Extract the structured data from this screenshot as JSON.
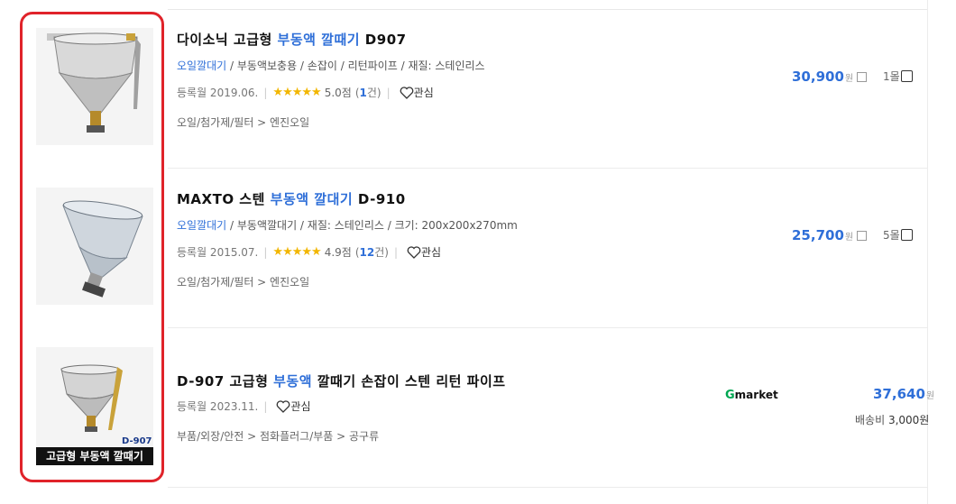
{
  "products": [
    {
      "title_pre": "다이소닉 고급형 ",
      "title_hl": "부동액 깔때기",
      "title_post": " D907",
      "specs_hl": "오일깔대기",
      "specs_rest": " / 부동액보충용 / 손잡이 / 리턴파이프 / 재질: 스테인리스",
      "reg_date": "등록월 2019.06.",
      "stars": "★★★★★",
      "score": "5.0점",
      "review_open": "(",
      "review_count": "1",
      "review_close": "건)",
      "wish_label": "관심",
      "category": "오일/첨가제/필터 > 엔진오일",
      "price": "30,900",
      "price_unit": "원",
      "sellers": "1몰"
    },
    {
      "title_pre": "MAXTO 스텐 ",
      "title_hl": "부동액 깔대기",
      "title_post": " D-910",
      "specs_hl": "오일깔대기",
      "specs_rest": " / 부동액깔대기 / 재질: 스테인리스 / 크기: 200x200x270mm",
      "reg_date": "등록월 2015.07.",
      "stars": "★★★★★",
      "score": "4.9점",
      "review_open": "(",
      "review_count": "12",
      "review_close": "건)",
      "wish_label": "관심",
      "category": "오일/첨가제/필터 > 엔진오일",
      "price": "25,700",
      "price_unit": "원",
      "sellers": "5몰"
    },
    {
      "title_pre": "D-907 고급형 ",
      "title_hl": "부동액",
      "title_post": " 깔때기 손잡이 스텐 리턴 파이프",
      "reg_date": "등록월 2023.11.",
      "wish_label": "관심",
      "category": "부품/외장/안전 > 점화플러그/부품 > 공구류",
      "price": "37,640",
      "price_unit": "원",
      "mall": "Gmarket",
      "mall_g": "G",
      "mall_rest": "market",
      "shipping_label": "배송비",
      "shipping_value": "3,000원",
      "image_model": "D-907",
      "image_badge": "고급형 부동액 깔때기"
    }
  ],
  "colors": {
    "highlight": "#e0232a",
    "accent": "#2f6fd8",
    "stars": "#f2b600",
    "gmarket": "#00a651"
  }
}
